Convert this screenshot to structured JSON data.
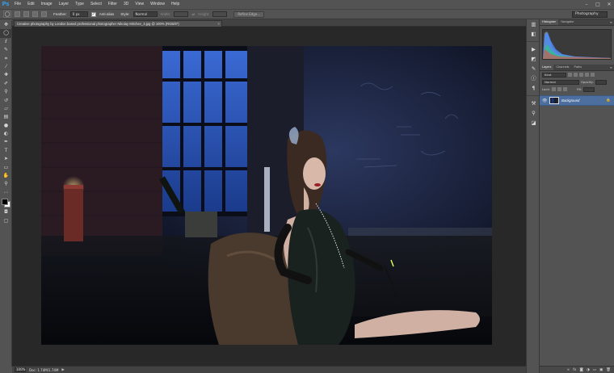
{
  "app": {
    "logo": "Ps"
  },
  "menu": [
    "File",
    "Edit",
    "Image",
    "Layer",
    "Type",
    "Select",
    "Filter",
    "3D",
    "View",
    "Window",
    "Help"
  ],
  "window_controls": [
    "–",
    "□",
    "✕"
  ],
  "options": {
    "feather_label": "Feather:",
    "feather_value": "0 px",
    "antialias_label": "Anti-alias",
    "style_label": "Style:",
    "style_value": "Normal",
    "width_label": "Width:",
    "height_label": "Height:",
    "refine_edge": "Refine Edge...",
    "workspace": "Photography"
  },
  "document": {
    "tab_title": "Creative photography by London based professional photographer Nikolay Mirchev_3.jpg @ 100% (RGB/8*)",
    "tab_close": "×"
  },
  "status": {
    "zoom": "100%",
    "doc_size": "Doc: 1.74M/1.74M",
    "arrow": "▶"
  },
  "panels": {
    "top_tabs": [
      "Histogram",
      "Navigator"
    ],
    "layer_tabs": [
      "Layers",
      "Channels",
      "Paths"
    ],
    "kind_label": "Kind",
    "blend_mode": "Normal",
    "opacity_label": "Opacity:",
    "lock_label": "Lock:",
    "fill_label": "Fill:",
    "layer_name": "Background",
    "menu_glyph": "≡"
  },
  "colors": {
    "accent": "#31a8ff",
    "selected_layer": "#4c6fa0"
  }
}
